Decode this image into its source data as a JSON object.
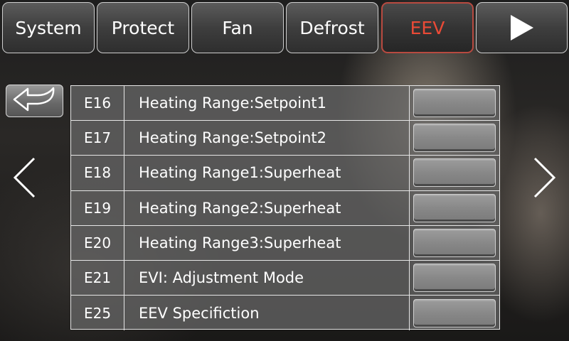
{
  "tabs": [
    {
      "label": "System",
      "active": false
    },
    {
      "label": "Protect",
      "active": false
    },
    {
      "label": "Fan",
      "active": false
    },
    {
      "label": "Defrost",
      "active": false
    },
    {
      "label": "EEV",
      "active": true
    }
  ],
  "icons": {
    "tab_next": "play-right-icon",
    "back": "return-arrow-icon",
    "prev_page": "chevron-left-icon",
    "next_page": "chevron-right-icon"
  },
  "colors": {
    "active_tab_text": "#ea4a36",
    "active_tab_border": "#b84a40"
  },
  "parameters": [
    {
      "code": "E16",
      "name": "Heating Range:Setpoint1",
      "value": ""
    },
    {
      "code": "E17",
      "name": "Heating Range:Setpoint2",
      "value": ""
    },
    {
      "code": "E18",
      "name": "Heating Range1:Superheat",
      "value": ""
    },
    {
      "code": "E19",
      "name": "Heating Range2:Superheat",
      "value": ""
    },
    {
      "code": "E20",
      "name": "Heating Range3:Superheat",
      "value": ""
    },
    {
      "code": "E21",
      "name": "EVI: Adjustment Mode",
      "value": ""
    },
    {
      "code": "E25",
      "name": "EEV Specifiction",
      "value": ""
    }
  ]
}
